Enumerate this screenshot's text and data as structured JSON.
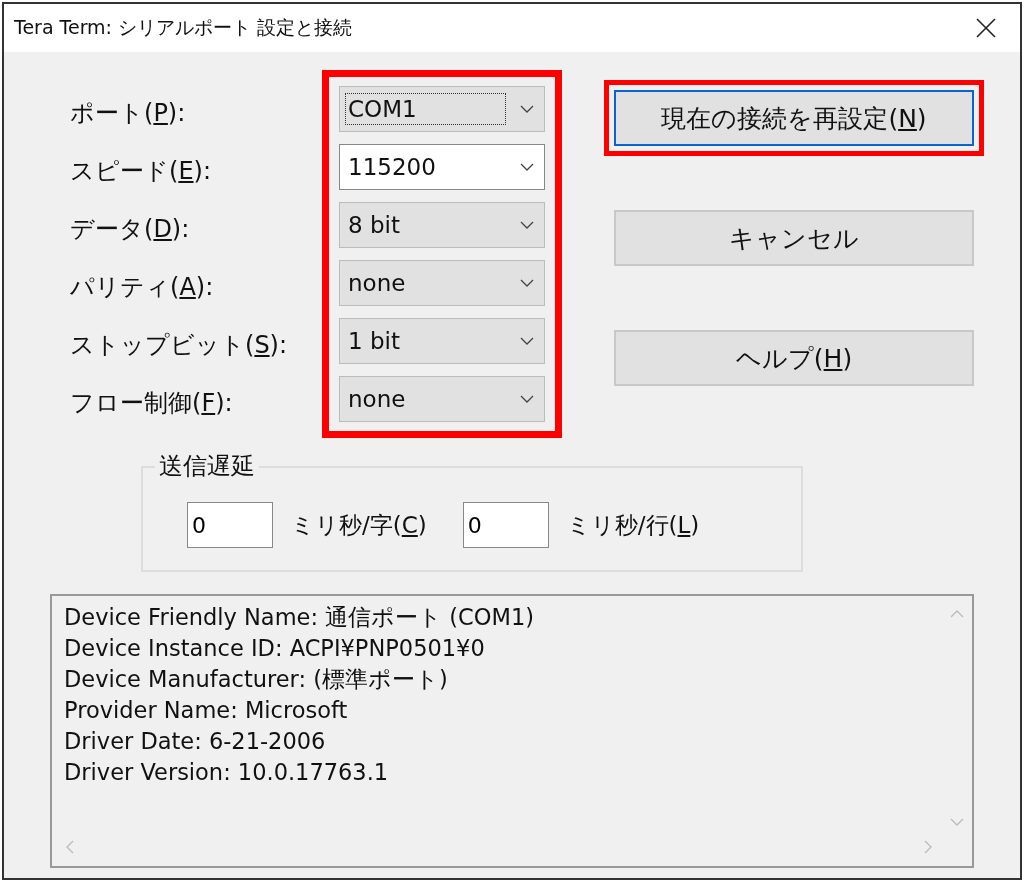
{
  "window": {
    "title": "Tera Term: シリアルポート 設定と接続"
  },
  "settings": {
    "highlighted": true,
    "fields": [
      {
        "label": {
          "before": "ポート(",
          "key": "P",
          "after": "):"
        },
        "kind": "dropdown",
        "value": "COM1",
        "focused": true
      },
      {
        "label": {
          "before": "スピード(",
          "key": "E",
          "after": "):"
        },
        "kind": "editable",
        "value": "115200",
        "focused": false
      },
      {
        "label": {
          "before": "データ(",
          "key": "D",
          "after": "):"
        },
        "kind": "dropdown",
        "value": "8 bit",
        "focused": false
      },
      {
        "label": {
          "before": "パリティ(",
          "key": "A",
          "after": "):"
        },
        "kind": "dropdown",
        "value": "none",
        "focused": false
      },
      {
        "label": {
          "before": "ストップビット(",
          "key": "S",
          "after": "):"
        },
        "kind": "dropdown",
        "value": "1 bit",
        "focused": false
      },
      {
        "label": {
          "before": "フロー制御(",
          "key": "F",
          "after": "):"
        },
        "kind": "dropdown",
        "value": "none",
        "focused": false
      }
    ]
  },
  "buttons": [
    {
      "label": {
        "before": "現在の接続を再設定(",
        "key": "N",
        "after": ")"
      },
      "default": true,
      "highlighted": true
    },
    {
      "label": {
        "before": "キャンセル"
      },
      "default": false,
      "highlighted": false
    },
    {
      "label": {
        "before": "ヘルプ(",
        "key": "H",
        "after": ")"
      },
      "default": false,
      "highlighted": false
    }
  ],
  "transmit_delay": {
    "title": "送信遅延",
    "fields": [
      {
        "value": "0",
        "unit": {
          "before": "ミリ秒/字(",
          "key": "C",
          "after": ")"
        }
      },
      {
        "value": "0",
        "unit": {
          "before": "ミリ秒/行(",
          "key": "L",
          "after": ")"
        }
      }
    ]
  },
  "device_info": [
    "Device Friendly Name: 通信ポート (COM1)",
    "Device Instance ID: ACPI¥PNP0501¥0",
    "Device Manufacturer: (標準ポート)",
    "Provider Name: Microsoft",
    "Driver Date: 6-21-2006",
    "Driver Version: 10.0.17763.1"
  ]
}
